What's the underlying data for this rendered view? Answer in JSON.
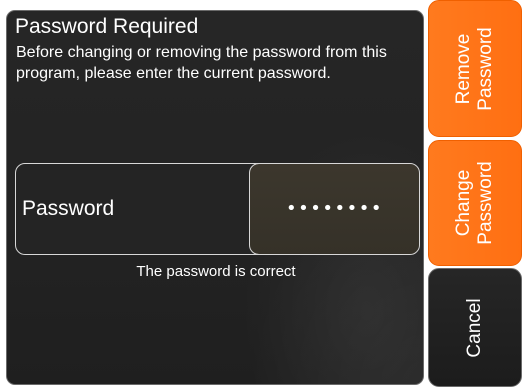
{
  "dialog": {
    "title": "Password Required",
    "description": "Before changing or removing the password from this program, please enter the current password.",
    "password_label": "Password",
    "password_mask": "••••••••",
    "status": "The password is correct"
  },
  "buttons": {
    "remove": [
      "Remove",
      "Password"
    ],
    "change": [
      "Change",
      "Password"
    ],
    "cancel": "Cancel"
  },
  "colors": {
    "panel_background": "#232323",
    "accent_orange": "#ff7a1e",
    "password_field": "#3a352c",
    "text": "#ffffff"
  }
}
